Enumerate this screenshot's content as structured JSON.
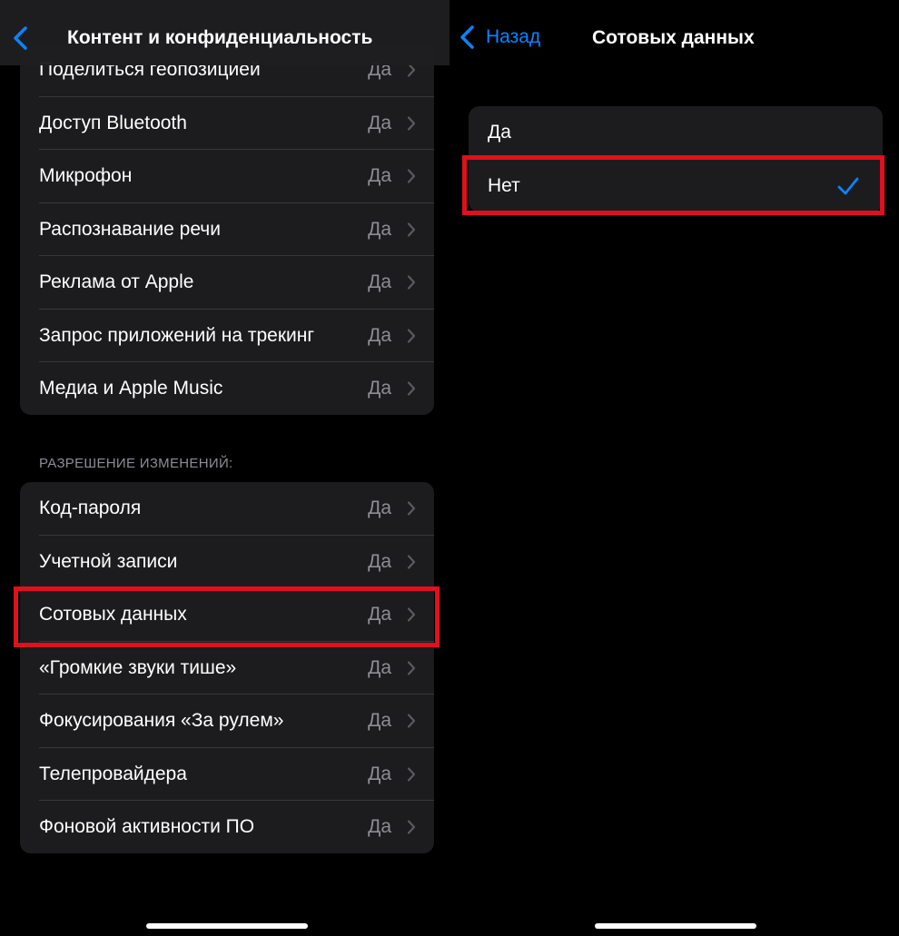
{
  "left_screen": {
    "nav_title": "Контент и конфиденциальность",
    "group1_rows": [
      {
        "label": "Поделиться геопозицией",
        "value": "Да"
      },
      {
        "label": "Доступ Bluetooth",
        "value": "Да"
      },
      {
        "label": "Микрофон",
        "value": "Да"
      },
      {
        "label": "Распознавание речи",
        "value": "Да"
      },
      {
        "label": "Реклама от Apple",
        "value": "Да"
      },
      {
        "label": "Запрос приложений на трекинг",
        "value": "Да"
      },
      {
        "label": "Медиа и Apple Music",
        "value": "Да"
      }
    ],
    "section_header": "РАЗРЕШЕНИЕ ИЗМЕНЕНИЙ:",
    "group2_rows": [
      {
        "label": "Код-пароля",
        "value": "Да"
      },
      {
        "label": "Учетной записи",
        "value": "Да"
      },
      {
        "label": "Сотовых данных",
        "value": "Да"
      },
      {
        "label": "«Громкие звуки тише»",
        "value": "Да"
      },
      {
        "label": "Фокусирования «За рулем»",
        "value": "Да"
      },
      {
        "label": "Телепровайдера",
        "value": "Да"
      },
      {
        "label": "Фоновой активности ПО",
        "value": "Да"
      }
    ]
  },
  "right_screen": {
    "back_label": "Назад",
    "nav_title": "Сотовых данных",
    "options": [
      {
        "label": "Да",
        "selected": false
      },
      {
        "label": "Нет",
        "selected": true
      }
    ]
  },
  "colors": {
    "accent": "#0a84ff",
    "highlight": "#e0101e",
    "cell_bg": "#1c1c1e",
    "secondary_text": "#8d8d93"
  },
  "icons": [
    "chevron-left-icon",
    "chevron-right-icon",
    "checkmark-icon"
  ]
}
